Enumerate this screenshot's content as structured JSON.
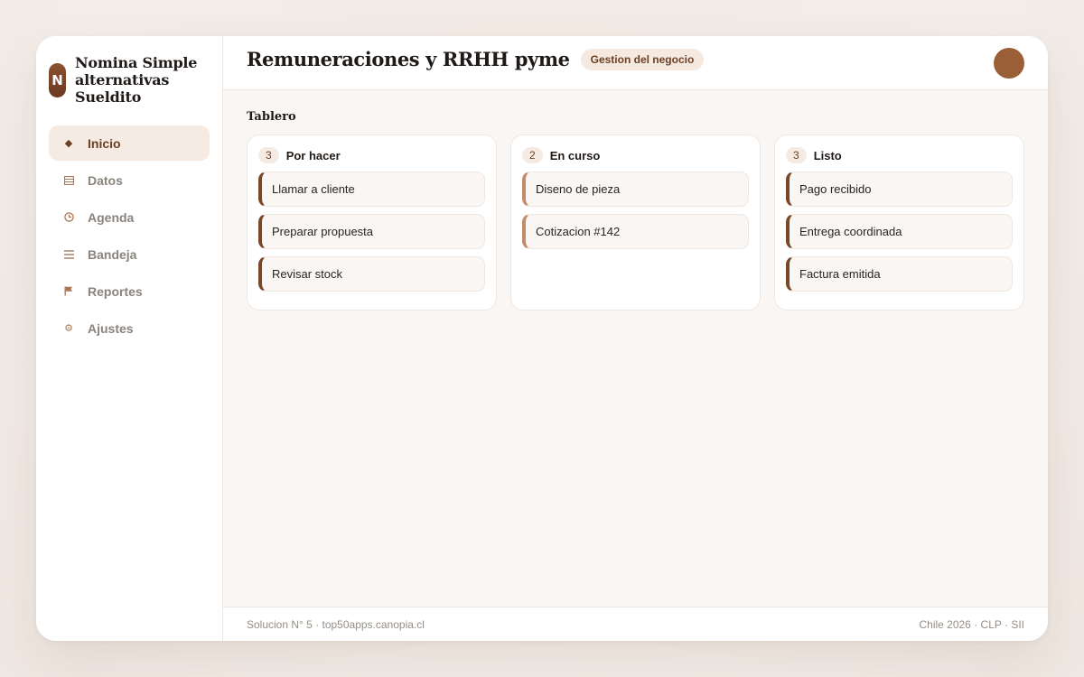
{
  "brand": {
    "logo_letter": "N",
    "name": "Nomina Simple alternativas Sueldito"
  },
  "sidebar": {
    "items": [
      {
        "label": "Inicio",
        "icon": "diamond-icon",
        "active": true
      },
      {
        "label": "Datos",
        "icon": "table-icon",
        "active": false
      },
      {
        "label": "Agenda",
        "icon": "clock-icon",
        "active": false
      },
      {
        "label": "Bandeja",
        "icon": "list-icon",
        "active": false
      },
      {
        "label": "Reportes",
        "icon": "flag-icon",
        "active": false
      },
      {
        "label": "Ajustes",
        "icon": "gear-icon",
        "active": false
      }
    ]
  },
  "header": {
    "title": "Remuneraciones y RRHH pyme",
    "badge": "Gestion del negocio"
  },
  "board": {
    "title": "Tablero",
    "columns": [
      {
        "count": "3",
        "title": "Por hacer",
        "cards": [
          "Llamar a cliente",
          "Preparar propuesta",
          "Revisar stock"
        ]
      },
      {
        "count": "2",
        "title": "En curso",
        "cards": [
          "Diseno de pieza",
          "Cotizacion #142"
        ]
      },
      {
        "count": "3",
        "title": "Listo",
        "cards": [
          "Pago recibido",
          "Entrega coordinada",
          "Factura emitida"
        ]
      }
    ]
  },
  "footer": {
    "left": "Solucion N° 5 · top50apps.canopia.cl",
    "right": "Chile 2026 · CLP · SII"
  },
  "colors": {
    "accent": "#7a4628",
    "accent_light": "#c48b68",
    "avatar": "#9a5f37",
    "active_bg": "#f6ebe3"
  }
}
